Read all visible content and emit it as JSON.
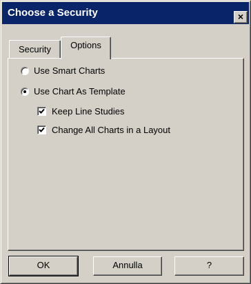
{
  "window": {
    "title": "Choose a Security",
    "close_label": "×"
  },
  "tabs": [
    {
      "label": "Security",
      "active": false
    },
    {
      "label": "Options",
      "active": true
    }
  ],
  "options": {
    "radio_smart_charts": {
      "label": "Use Smart Charts",
      "selected": false
    },
    "radio_chart_template": {
      "label": "Use Chart As Template",
      "selected": true
    },
    "check_keep_line_studies": {
      "label": "Keep Line Studies",
      "checked": true
    },
    "check_change_all_charts": {
      "label": "Change All Charts in a Layout",
      "checked": true
    }
  },
  "buttons": {
    "ok": "OK",
    "cancel": "Annulla",
    "help": "?"
  },
  "colors": {
    "titlebar": "#0a246a",
    "face": "#d4d0c8"
  }
}
